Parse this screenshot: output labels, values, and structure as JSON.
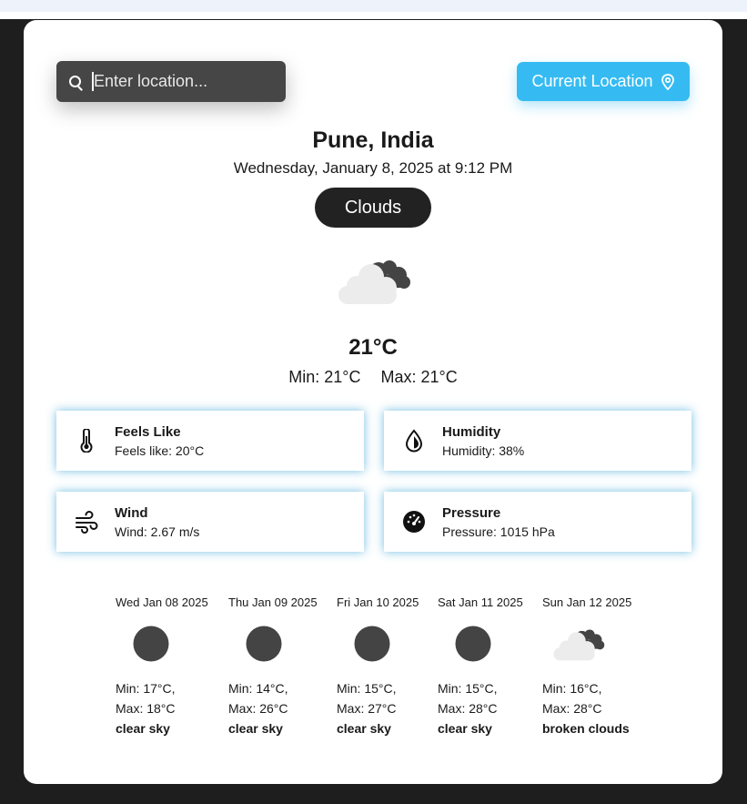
{
  "search": {
    "placeholder": "Enter location...",
    "value": ""
  },
  "current_location_label": "Current Location",
  "location": {
    "city": "Pune, India",
    "datetime": "Wednesday, January 8, 2025 at 9:12 PM"
  },
  "condition": "Clouds",
  "temperature": "21°C",
  "min_temp": "Min: 21°C",
  "max_temp": "Max: 21°C",
  "stats": [
    {
      "title": "Feels Like",
      "value": "Feels like: 20°C",
      "icon": "thermometer-icon"
    },
    {
      "title": "Humidity",
      "value": "Humidity: 38%",
      "icon": "humidity-drop-icon"
    },
    {
      "title": "Wind",
      "value": "Wind: 2.67 m/s",
      "icon": "wind-icon"
    },
    {
      "title": "Pressure",
      "value": "Pressure: 1015 hPa",
      "icon": "pressure-gauge-icon"
    }
  ],
  "forecast": [
    {
      "date": "Wed Jan 08 2025",
      "min": "Min: 17°C,",
      "max": "Max: 18°C",
      "desc": "clear sky",
      "icon": "clear-sky-icon"
    },
    {
      "date": "Thu Jan 09 2025",
      "min": "Min: 14°C,",
      "max": "Max: 26°C",
      "desc": "clear sky",
      "icon": "clear-sky-icon"
    },
    {
      "date": "Fri Jan 10 2025",
      "min": "Min: 15°C,",
      "max": "Max: 27°C",
      "desc": "clear sky",
      "icon": "clear-sky-icon"
    },
    {
      "date": "Sat Jan 11 2025",
      "min": "Min: 15°C,",
      "max": "Max: 28°C",
      "desc": "clear sky",
      "icon": "clear-sky-icon"
    },
    {
      "date": "Sun Jan 12 2025",
      "min": "Min: 16°C,",
      "max": "Max: 28°C",
      "desc": "broken clouds",
      "icon": "broken-clouds-icon"
    }
  ],
  "colors": {
    "accent": "#35bbf2",
    "pill": "#222222",
    "search_bg": "#464646",
    "page_bg": "#1e1e1e"
  }
}
